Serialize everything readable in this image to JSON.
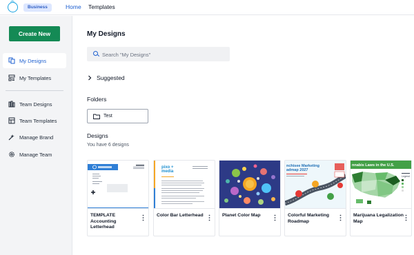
{
  "topbar": {
    "badge": "Business",
    "nav": {
      "home": "Home",
      "templates": "Templates"
    }
  },
  "sidebar": {
    "create_label": "Create New",
    "items": [
      {
        "label": "My Designs",
        "icon": "designs-icon",
        "active": true
      },
      {
        "label": "My Templates",
        "icon": "templates-icon"
      },
      {
        "label": "Team Designs",
        "icon": "team-designs-icon"
      },
      {
        "label": "Team Templates",
        "icon": "team-templates-icon"
      },
      {
        "label": "Manage Brand",
        "icon": "brand-icon"
      },
      {
        "label": "Manage Team",
        "icon": "gear-icon"
      }
    ]
  },
  "main": {
    "title": "My Designs",
    "search_placeholder": "Search \"My Designs\"",
    "suggested": "Suggested",
    "folders_title": "Folders",
    "folder_name": "Test",
    "designs_title": "Designs",
    "designs_count_text": "You have 6 designs",
    "cards": [
      {
        "title": "TEMPLATE Accounting Letterhead"
      },
      {
        "title": "Color Bar Letterhead"
      },
      {
        "title": "Planet Color Map"
      },
      {
        "title": "Colorful Marketing Roadmap"
      },
      {
        "title": "Marijuana Legalization Map"
      }
    ],
    "thumb_text": {
      "letterhead_brand": "pixo + media",
      "roadmap_heading": "nchisee Marketing\nadmap 2027",
      "map_heading": "nnabis Laws in the U.S.",
      "map_legend": "Legend"
    }
  },
  "colors": {
    "brand_green": "#148a55",
    "accent_blue": "#1d5fd0",
    "badge_bg": "#dde7ff"
  }
}
